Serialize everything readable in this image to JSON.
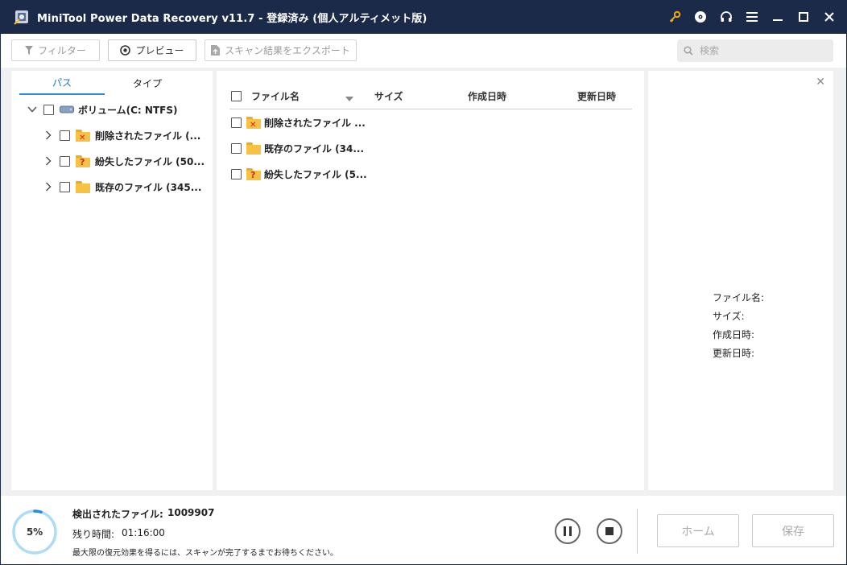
{
  "window": {
    "title": "MiniTool Power Data Recovery v11.7 - 登録済み (個人アルティメット版)"
  },
  "title_icons": [
    "key-icon",
    "disc-icon",
    "headset-icon",
    "menu-icon",
    "minimize-icon",
    "maximize-icon",
    "close-icon"
  ],
  "toolbar": {
    "filter_label": "フィルター",
    "preview_label": "プレビュー",
    "export_label": "スキャン結果をエクスポート",
    "search_placeholder": "検索"
  },
  "tabs": [
    "パス",
    "タイプ"
  ],
  "tree": {
    "root": "ボリューム(C: NTFS)",
    "items": [
      {
        "label": "削除されたファイル (...",
        "icon": "deleted-folder-icon"
      },
      {
        "label": "紛失したファイル (50...",
        "icon": "lost-folder-icon"
      },
      {
        "label": "既存のファイル (345...",
        "icon": "existing-folder-icon"
      }
    ]
  },
  "file_list": {
    "columns": {
      "name": "ファイル名",
      "size": "サイズ",
      "created": "作成日時",
      "modified": "更新日時"
    },
    "rows": [
      {
        "name": "削除されたファイル ...",
        "icon": "deleted-folder-icon"
      },
      {
        "name": "既存のファイル (34...",
        "icon": "existing-folder-icon"
      },
      {
        "name": "紛失したファイル (5...",
        "icon": "lost-folder-icon"
      }
    ]
  },
  "details": {
    "name": "ファイル名:",
    "size": "サイズ:",
    "created": "作成日時:",
    "modified": "更新日時:"
  },
  "status": {
    "progress_label": "5%",
    "progress_fraction": 0.05,
    "found_label": "検出されたファイル:",
    "found_value": "1009907",
    "remaining_label": "残り時間:",
    "remaining_value": "01:16:00",
    "hint": "最大限の復元効果を得るには、スキャンが完了するまでお待ちください。",
    "home_label": "ホーム",
    "save_label": "保存"
  },
  "colors": {
    "titlebar": "#1c2a4a",
    "accent": "#2a8ad8",
    "selection": "#cde6f7",
    "key_icon": "#f0a800"
  }
}
